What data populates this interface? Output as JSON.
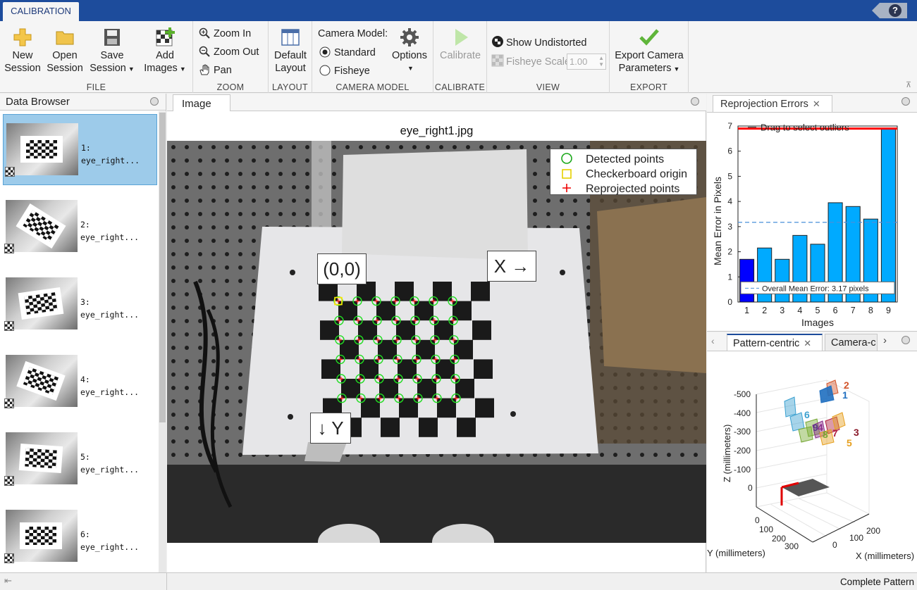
{
  "app": {
    "tab": "CALIBRATION",
    "help_glyph": "?"
  },
  "toolstrip": {
    "file": {
      "label": "FILE",
      "new_session": [
        "New",
        "Session"
      ],
      "open_session": [
        "Open",
        "Session"
      ],
      "save_session": [
        "Save",
        "Session"
      ],
      "add_images": [
        "Add",
        "Images"
      ]
    },
    "zoom": {
      "label": "ZOOM",
      "zoom_in": "Zoom In",
      "zoom_out": "Zoom Out",
      "pan": "Pan"
    },
    "layout": {
      "label": "LAYOUT",
      "default_layout": [
        "Default",
        "Layout"
      ]
    },
    "camera_model": {
      "label": "CAMERA MODEL",
      "title": "Camera Model:",
      "standard": "Standard",
      "fisheye": "Fisheye",
      "selected": "Standard",
      "options": "Options"
    },
    "calibrate": {
      "label": "CALIBRATE",
      "calibrate": "Calibrate"
    },
    "view": {
      "label": "VIEW",
      "show_undistorted": "Show Undistorted",
      "fisheye_scale": "Fisheye Scale",
      "fisheye_scale_value": "1.00"
    },
    "export": {
      "label": "EXPORT",
      "export_params": [
        "Export Camera",
        "Parameters"
      ]
    }
  },
  "data_browser": {
    "title": "Data Browser",
    "items": [
      {
        "index": "1:",
        "name": "eye_right...",
        "selected": true
      },
      {
        "index": "2:",
        "name": "eye_right..."
      },
      {
        "index": "3:",
        "name": "eye_right..."
      },
      {
        "index": "4:",
        "name": "eye_right..."
      },
      {
        "index": "5:",
        "name": "eye_right..."
      },
      {
        "index": "6:",
        "name": "eye_right..."
      }
    ]
  },
  "image_panel": {
    "tab": "Image",
    "title": "eye_right1.jpg",
    "legend": [
      "Detected points",
      "Checkerboard origin",
      "Reprojected points"
    ],
    "origin_label": "(0,0)",
    "x_label": "X →",
    "y_label": "↓ Y"
  },
  "reprojection": {
    "tab": "Reprojection Errors",
    "drag_hint": "Drag to select outliers",
    "mean_label": "Overall Mean Error: 3.17 pixels",
    "chart_data": {
      "type": "bar",
      "categories": [
        "1",
        "2",
        "3",
        "4",
        "5",
        "6",
        "7",
        "8",
        "9"
      ],
      "values": [
        1.7,
        2.15,
        1.7,
        2.65,
        2.3,
        3.95,
        3.8,
        3.3,
        6.9
      ],
      "highlighted_index": 0,
      "mean": 3.17,
      "ylim": [
        0,
        7
      ],
      "yticks": [
        0,
        1,
        2,
        3,
        4,
        5,
        6,
        7
      ],
      "xlabel": "Images",
      "ylabel": "Mean Error in Pixels",
      "colors": {
        "bar": "#00aaff",
        "selected": "#0000ff",
        "mean_line": "#4a90d9",
        "threshold": "#ff0000"
      }
    }
  },
  "pattern_panel": {
    "tabs": [
      "Pattern-centric",
      "Camera-c"
    ],
    "z_label": "Z (millimeters)",
    "y_label": "Y (millimeters)",
    "x_label": "X (millimeters)",
    "z_ticks": [
      "-500",
      "-400",
      "-300",
      "-200",
      "-100",
      "0"
    ],
    "y_ticks": [
      "0",
      "100",
      "200",
      "300"
    ],
    "x_ticks": [
      "0",
      "100",
      "200"
    ],
    "camera_labels": [
      {
        "text": "2",
        "color": "#d2542a"
      },
      {
        "text": "1",
        "color": "#1f6fc0"
      },
      {
        "text": "6",
        "color": "#3aa0d0"
      },
      {
        "text": "9",
        "color": "#5a3a8a"
      },
      {
        "text": "4",
        "color": "#8a2c8a"
      },
      {
        "text": "8",
        "color": "#77aa33"
      },
      {
        "text": "7",
        "color": "#b02040"
      },
      {
        "text": "3",
        "color": "#8a1a2a"
      },
      {
        "text": "5",
        "color": "#e6a020"
      }
    ]
  },
  "status": {
    "text": "Complete Pattern"
  }
}
